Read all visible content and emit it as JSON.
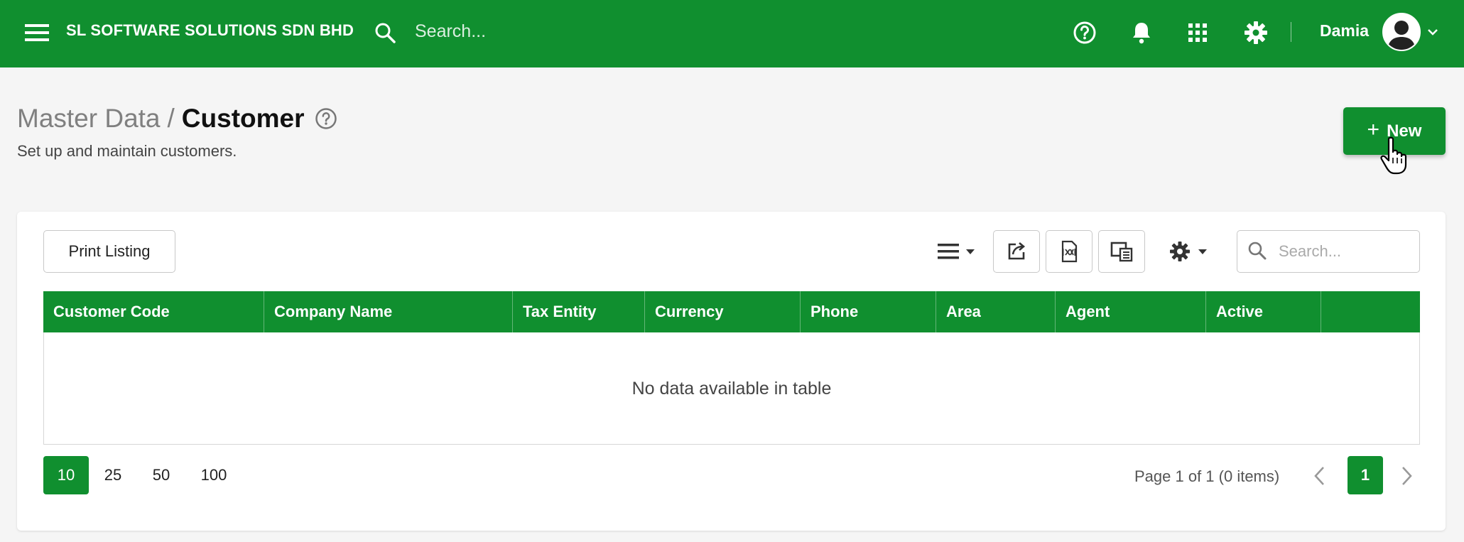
{
  "topbar": {
    "company": "SL SOFTWARE SOLUTIONS SDN BHD",
    "search_placeholder": "Search...",
    "username": "Damia",
    "icons": [
      "menu-icon",
      "search-icon",
      "help-icon",
      "bell-icon",
      "apps-grid-icon",
      "gear-icon",
      "avatar",
      "chevron-down-icon"
    ],
    "color": "#108f2f"
  },
  "page": {
    "breadcrumb_parent": "Master Data",
    "breadcrumb_sep": "/",
    "title": "Customer",
    "subtitle": "Set up and maintain customers.",
    "new_label": "New",
    "new_plus": "+"
  },
  "toolbar": {
    "print_label": "Print Listing",
    "search_placeholder": "Search...",
    "icons": [
      "list-menu-icon",
      "export-icon",
      "xml-file-icon",
      "column-chooser-icon",
      "settings-gear-icon"
    ]
  },
  "table": {
    "columns": [
      "Customer Code",
      "Company Name",
      "Tax Entity",
      "Currency",
      "Phone",
      "Area",
      "Agent",
      "Active",
      ""
    ],
    "empty_message": "No data available in table"
  },
  "pager": {
    "sizes": [
      "10",
      "25",
      "50",
      "100"
    ],
    "active_size": "10",
    "info": "Page 1 of 1 (0 items)",
    "current_page": "1"
  }
}
